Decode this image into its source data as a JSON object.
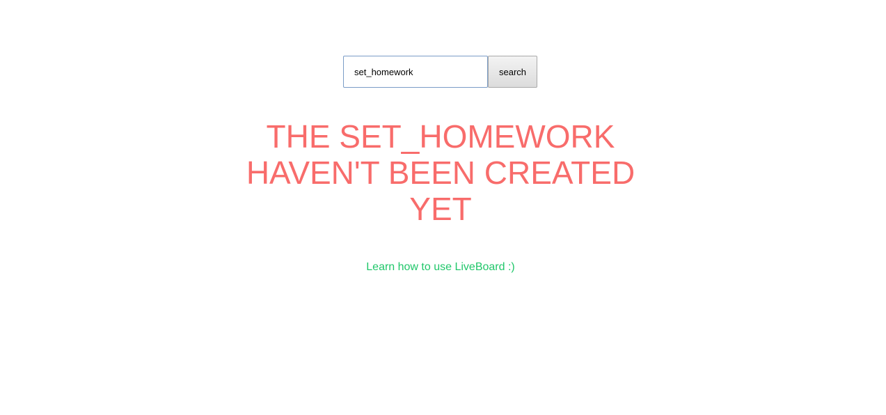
{
  "search": {
    "value": "set_homework",
    "button_label": "search"
  },
  "message": {
    "text": "THE SET_HOMEWORK HAVEN'T BEEN CREATED YET"
  },
  "help_link": {
    "label": "Learn how to use LiveBoard :)"
  },
  "colors": {
    "error_text": "#f86c6b",
    "link": "#20c76a",
    "input_border": "#7a9cc6"
  }
}
